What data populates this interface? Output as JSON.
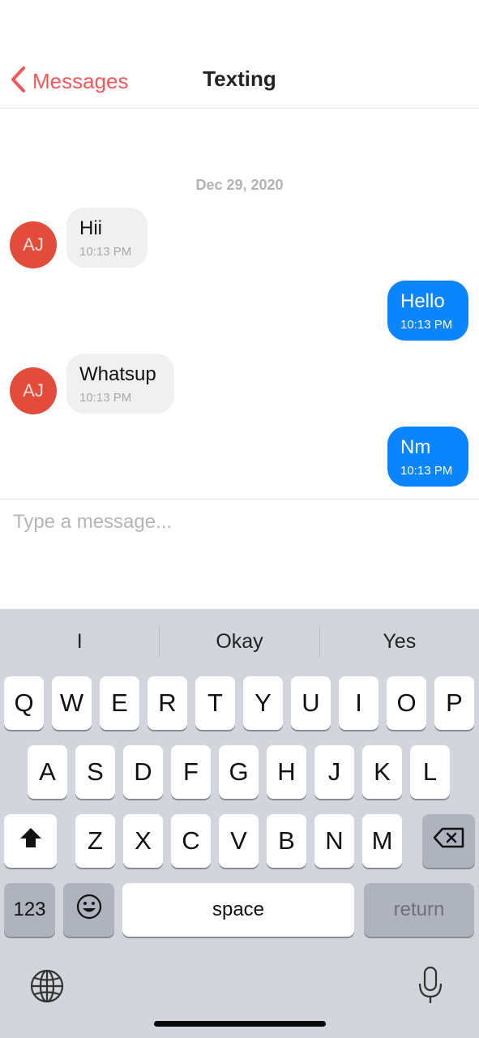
{
  "header": {
    "back_label": "Messages",
    "title": "Texting"
  },
  "chat": {
    "date": "Dec 29, 2020",
    "messages": [
      {
        "direction": "in",
        "avatar": "AJ",
        "text": "Hii",
        "time": "10:13 PM"
      },
      {
        "direction": "out",
        "text": "Hello",
        "time": "10:13 PM"
      },
      {
        "direction": "in",
        "avatar": "AJ",
        "text": "Whatsup",
        "time": "10:13 PM"
      },
      {
        "direction": "out",
        "text": "Nm",
        "time": "10:13 PM"
      }
    ]
  },
  "composer": {
    "placeholder": "Type a message..."
  },
  "keyboard": {
    "suggestions": [
      "I",
      "Okay",
      "Yes"
    ],
    "row1": [
      "Q",
      "W",
      "E",
      "R",
      "T",
      "Y",
      "U",
      "I",
      "O",
      "P"
    ],
    "row2": [
      "A",
      "S",
      "D",
      "F",
      "G",
      "H",
      "J",
      "K",
      "L"
    ],
    "row3": [
      "Z",
      "X",
      "C",
      "V",
      "B",
      "N",
      "M"
    ],
    "numbers_label": "123",
    "space_label": "space",
    "return_label": "return",
    "shift_icon": "shift-icon",
    "backspace_icon": "backspace-icon",
    "emoji_icon": "emoji-icon",
    "globe_icon": "globe-icon",
    "mic_icon": "microphone-icon"
  },
  "colors": {
    "accent": "#f0595b",
    "outgoing_bubble": "#0a84ff",
    "incoming_bubble": "#f0f0f0",
    "avatar": "#e34b3b",
    "keyboard_bg": "#d2d5db"
  }
}
